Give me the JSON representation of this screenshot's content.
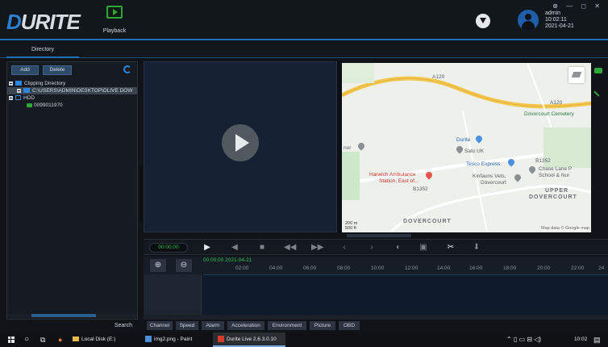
{
  "header": {
    "logo": "URITE",
    "logo_d": "D",
    "playback_label": "Playback",
    "user": {
      "name": "admin",
      "time": "10:02:11",
      "date": "2021-04-21"
    },
    "window_controls": "⊗ — ◻ ✕"
  },
  "tabs": {
    "directory": "Directory"
  },
  "left_panel": {
    "add_label": "Add",
    "delete_label": "Delete",
    "tree": [
      {
        "label": "Clipping Directory"
      },
      {
        "label": "C:\\USERS\\ADMIN\\DESKTOP\\DLIVE DOW"
      },
      {
        "label": "HDD"
      },
      {
        "label": "0099011970"
      }
    ],
    "search_label": "Search"
  },
  "map": {
    "labels": {
      "a120_top": "A120",
      "a120_right": "A120",
      "cemetery": "Dovercourt Cemetery",
      "durite": "Durite",
      "sato": "Sato UK",
      "tesco": "Tesco Express",
      "ambulance1": "Harwich Ambulance",
      "ambulance2": "Station, East of...",
      "kinfauns1": "Kinfauns Vets,",
      "kinfauns2": "Dovercourt",
      "chase1": "Chase Lane P",
      "chase2": "School & Nur",
      "upper1": "UPPER",
      "upper2": "DOVERCOURT",
      "dovercourt": "DOVERCOURT",
      "b1352": "B1352",
      "b1352b": "B1352",
      "nor": "nor",
      "scale_m": "200 m",
      "scale_ft": "500 ft",
      "map_data": "Map data © Google map"
    }
  },
  "playback": {
    "time": "00:00:00",
    "controls": [
      "play-icon",
      "prev-frame-icon",
      "stop-icon",
      "rewind-icon",
      "fast-forward-icon",
      "previous-icon",
      "next-icon",
      "volume-icon",
      "snapshot-icon",
      "clip-icon",
      "download-clip-icon"
    ]
  },
  "timeline": {
    "date": "00:00:00 2021-04-21",
    "ticks": [
      "02:00",
      "04:00",
      "06:00",
      "08:00",
      "10:00",
      "12:00",
      "14:00",
      "16:00",
      "18:00",
      "20:00",
      "22:00",
      "24"
    ]
  },
  "bottom_tabs": [
    "Channel",
    "Speed",
    "Alarm",
    "Acceleration",
    "Environment",
    "Picture",
    "OBD"
  ],
  "taskbar": {
    "local_disk": "Local Disk (E:)",
    "paint": "img2.png - Paint",
    "durite": "Durite Live 2.6.3.0.10",
    "clock": "10:02"
  },
  "colors": {
    "accent": "#1e6fb5",
    "green": "#2fa83a",
    "bg": "#101418"
  }
}
